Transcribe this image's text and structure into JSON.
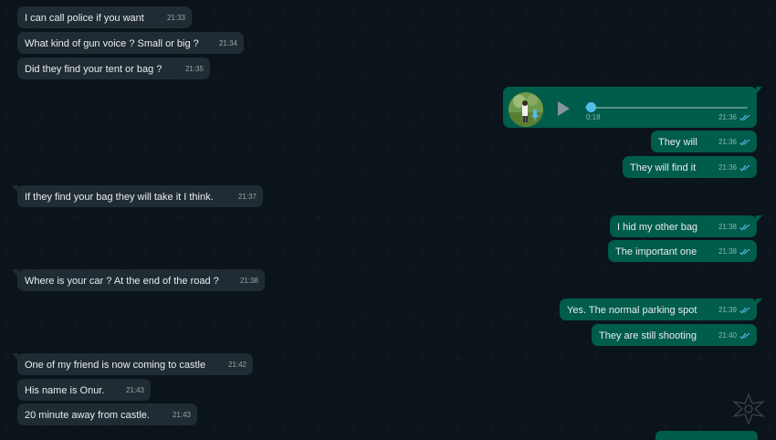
{
  "incoming_group1": [
    {
      "text": "I can call police if you want",
      "time": "21:33"
    },
    {
      "text": "What kind of gun voice ? Small or big ?",
      "time": "21:34"
    },
    {
      "text": "Did they find your tent or bag ?",
      "time": "21:35"
    }
  ],
  "voice_message": {
    "duration": "0:18",
    "time": "21:36",
    "progress": 0.0
  },
  "outgoing_group1": [
    {
      "text": "They will",
      "time": "21:36"
    },
    {
      "text": "They will find it",
      "time": "21:36"
    }
  ],
  "incoming_group2": [
    {
      "text": "If they find your bag they will take it I think.",
      "time": "21:37"
    }
  ],
  "outgoing_group2": [
    {
      "text": "I hid my other bag",
      "time": "21:38"
    },
    {
      "text": "The important one",
      "time": "21:38"
    }
  ],
  "incoming_group3": [
    {
      "text": "Where is your car ? At the end of the road ?",
      "time": "21:38"
    }
  ],
  "outgoing_group3": [
    {
      "text": "Yes. The normal parking spot",
      "time": "21:39"
    },
    {
      "text": "They are still shooting",
      "time": "21:40"
    }
  ],
  "incoming_group4": [
    {
      "text": "One of my friend is now coming to castle",
      "time": "21:42"
    },
    {
      "text": "His name is Onur.",
      "time": "21:43"
    },
    {
      "text": "20 minute away from castle.",
      "time": "21:43"
    }
  ],
  "colors": {
    "incoming": "#202c33",
    "outgoing": "#005c4b",
    "read_ticks": "#53bdeb",
    "background": "#0b141a"
  },
  "icons": [
    "play-icon",
    "double-check-read-icon",
    "microphone-icon",
    "watermark-logo-icon"
  ]
}
